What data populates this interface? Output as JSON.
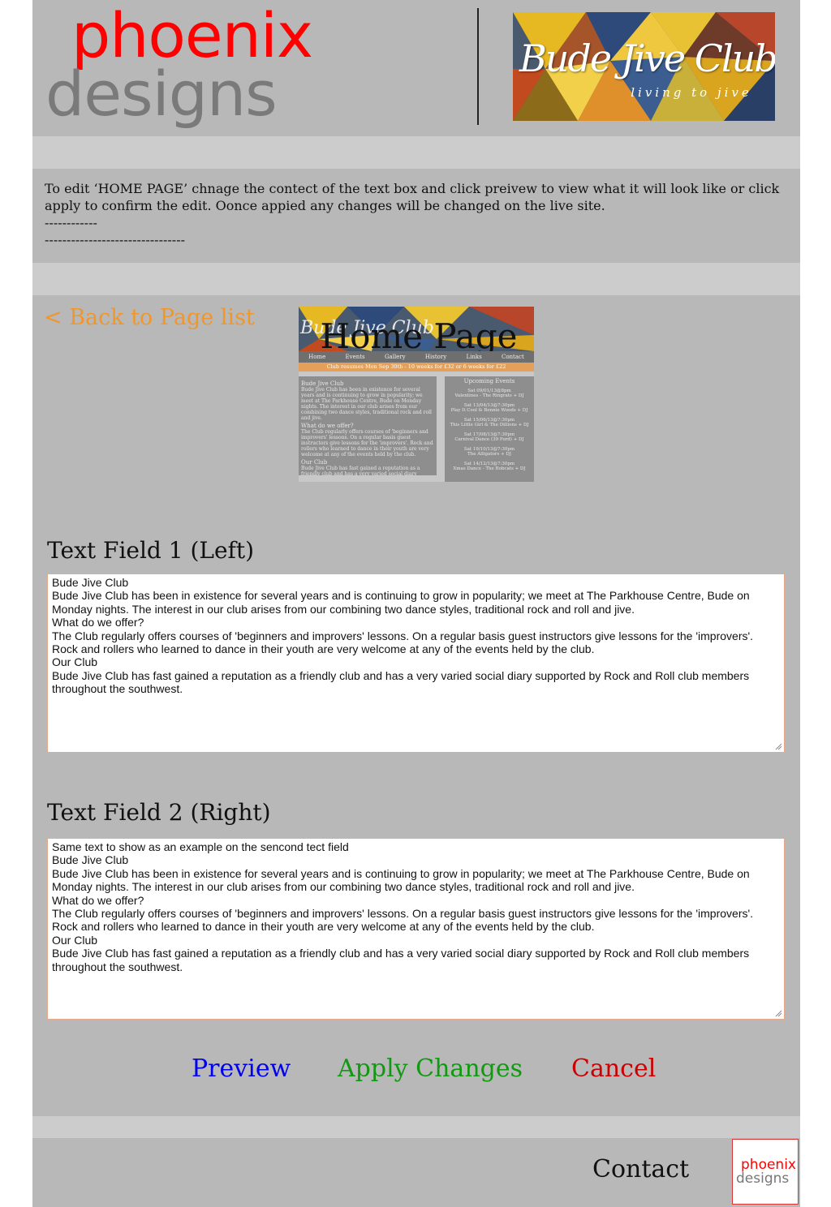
{
  "brand": {
    "logo_line1": "phoenix",
    "logo_line2": "designs"
  },
  "club_banner": {
    "title": "Bude Jive Club",
    "tagline": "living to jive"
  },
  "instructions": {
    "line1": "To edit ‘HOME PAGE’ chnage the contect of the text box and click preivew to view what it will look like or click apply to confirm the edit. Oonce appied any changes will be changed on the live site.",
    "line2": "------------",
    "line3": "--------------------------------"
  },
  "nav": {
    "back_label": "< Back to Page list"
  },
  "preview_thumbnail": {
    "heading": "Home Page",
    "banner_text": "Bude Jive Club",
    "nav_items": [
      "Home",
      "Events",
      "Gallery",
      "History",
      "Links",
      "Contact"
    ],
    "notice": "Club resumes Mon Sep 30th - 10 weeks for £32 or 6 weeks for £22",
    "left_title": "Bude Jive Club",
    "left_p1": "Bude Jive Club has been in existence for several years and is continuing to grow in popularity; we meet at The Parkhouse Centre, Bude on Monday nights. The interest in our club arises from our combining two dance styles, traditional rock and roll and jive.",
    "left_h2": "What do we offer?",
    "left_p2": "The Club regularly offers courses of 'beginners and improvers' lessons. On a regular basis guest instructors give lessons for the 'improvers'. Rock and rollers who learned to dance in their youth are very welcome at any of the events held by the club.",
    "left_h3": "Our Club",
    "left_p3": "Bude Jive Club has fast gained a reputation as a friendly club and has a very varied social diary supported by Rock and Roll club members throughout the southwest.",
    "right_title": "Upcoming Events",
    "events": [
      {
        "date": "Sat 09/01/13@8pm",
        "desc": "Valentines - The Ringrats + DJ"
      },
      {
        "date": "Sat 13/04/13@7:30pm",
        "desc": "Play It Cool & Bennie Woods + DJ"
      },
      {
        "date": "Sat 15/06/13@7:30pm",
        "desc": "This Little Girl & The Dillions + DJ"
      },
      {
        "date": "Sat 17/08/13@7:30pm",
        "desc": "Carnival Dance (39 Ford) + DJ"
      },
      {
        "date": "Sat 19/10/13@7:30pm",
        "desc": "The Alligators + DJ"
      },
      {
        "date": "Sat 14/12/13@7:30pm",
        "desc": "Xmas Dance - The Bobcats + DJ"
      }
    ]
  },
  "field1": {
    "label": "Text Field 1 (Left)",
    "lines": [
      "Bude Jive Club",
      "Bude Jive Club has been in existence for several years and is continuing to grow in popularity; we meet at The Parkhouse Centre, Bude on Monday nights. The interest in our club arises from our combining two dance styles, traditional rock and roll and jive.",
      "What do we offer?",
      "The Club regularly offers courses of 'beginners and improvers' lessons. On a regular basis guest instructors give lessons for the 'improvers'. Rock and rollers who learned to dance in their youth are very welcome at any of the events held by the club.",
      "Our Club",
      "Bude Jive Club has fast gained a reputation as a friendly club and has a very varied social diary supported by Rock and Roll club members throughout the southwest."
    ]
  },
  "field2": {
    "label": "Text Field 2 (Right)",
    "lines": [
      "Same text to show as an example on the sencond tect field",
      "Bude Jive Club",
      "Bude Jive Club has been in existence for several years and is continuing to grow in popularity; we meet at The Parkhouse Centre, Bude on Monday nights. The interest in our club arises from our combining two dance styles, traditional rock and roll and jive.",
      "What do we offer?",
      "The Club regularly offers courses of 'beginners and improvers' lessons. On a regular basis guest instructors give lessons for the 'improvers'. Rock and rollers who learned to dance in their youth are very welcome at any of the events held by the club.",
      "Our Club",
      "Bude Jive Club has fast gained a reputation as a friendly club and has a very varied social diary supported by Rock and Roll club members throughout the southwest."
    ]
  },
  "actions": {
    "preview": "Preview",
    "apply": "Apply Changes",
    "cancel": "Cancel"
  },
  "footer": {
    "contact": "Contact",
    "logo_line1": "phoenix",
    "logo_line2": "designs"
  },
  "colors": {
    "page_bg": "#b8b8b8",
    "strip": "#cccccc",
    "brand_red": "#ff0000",
    "brand_grey": "#7a7a7a",
    "back_link": "#f0962b",
    "preview": "#0000ee",
    "apply": "#119911",
    "cancel": "#cc0000"
  }
}
